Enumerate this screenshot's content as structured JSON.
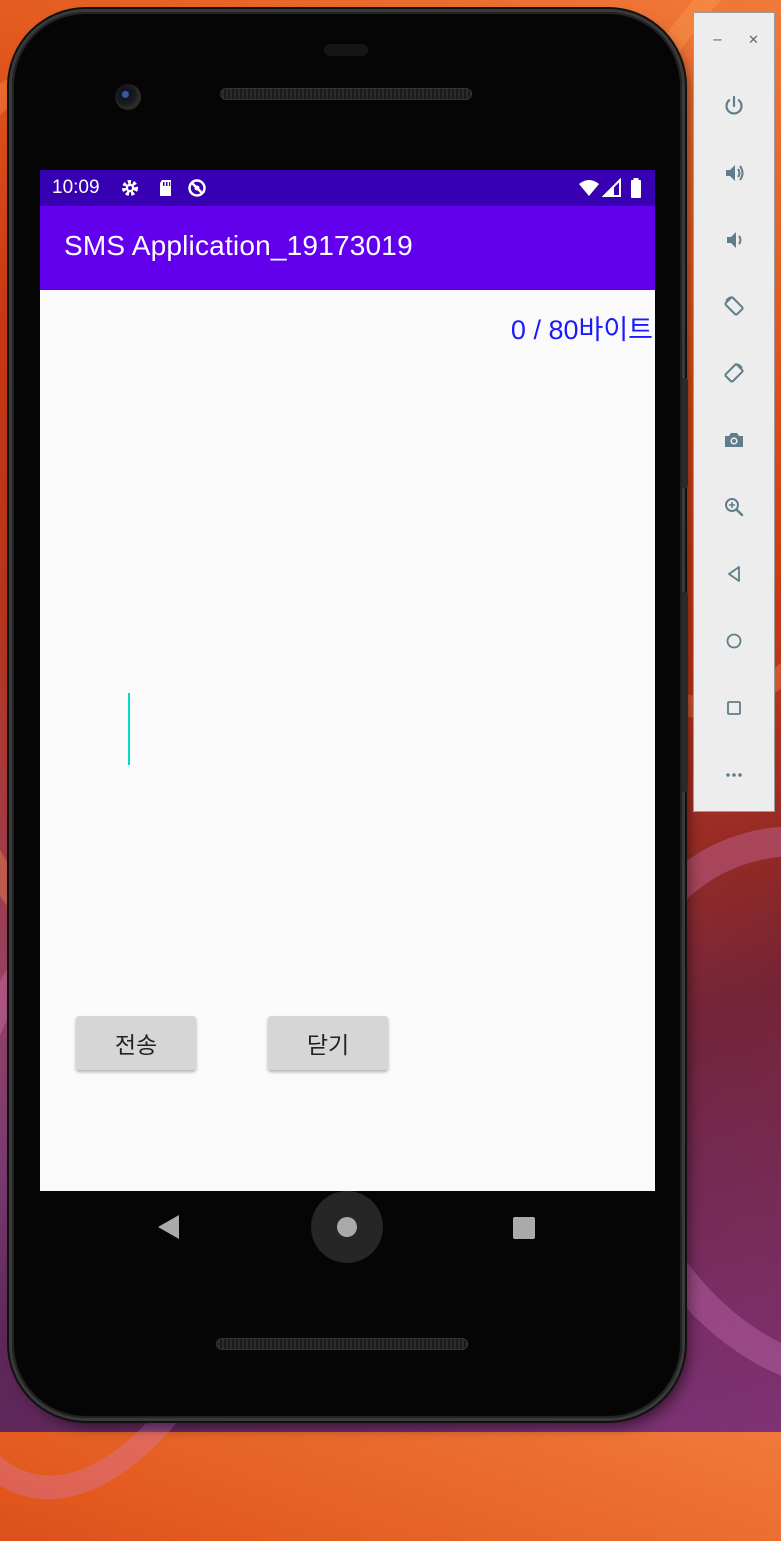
{
  "status_bar": {
    "time": "10:09",
    "left_icons": [
      "settings-icon",
      "sd-card-icon",
      "data-saver-icon"
    ],
    "right_icons": [
      "wifi-icon",
      "signal-icon",
      "battery-icon"
    ],
    "color": "#3700b3"
  },
  "app_bar": {
    "title": "SMS Application_19173019",
    "color": "#6200ee"
  },
  "message": {
    "byte_counter": "0 / 80바이트",
    "input_value": "",
    "cursor_color": "#03dac5"
  },
  "buttons": {
    "send_label": "전송",
    "close_label": "닫기"
  },
  "nav_bar": {
    "icons": [
      "back-icon",
      "home-icon",
      "recents-icon"
    ]
  },
  "emulator_panel": {
    "window_controls": [
      "minimize-icon",
      "close-icon"
    ],
    "controls": [
      "power-icon",
      "volume-up-icon",
      "volume-down-icon",
      "rotate-left-icon",
      "rotate-right-icon",
      "camera-icon",
      "zoom-icon",
      "back-icon",
      "home-icon",
      "overview-icon",
      "more-icon"
    ]
  }
}
